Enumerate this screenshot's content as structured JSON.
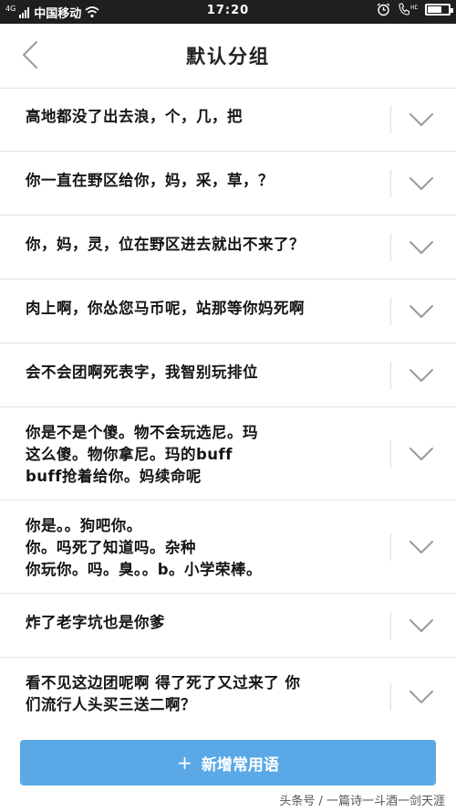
{
  "status_bar": {
    "network": "4G",
    "carrier": "中国移动",
    "time": "17:20",
    "battery_level": 0.7
  },
  "nav": {
    "title": "默认分组"
  },
  "phrases": [
    {
      "text": "高地都没了出去浪，个，几，把"
    },
    {
      "text": "你一直在野区给你，妈，采，草，？"
    },
    {
      "text": "你，妈，灵，位在野区进去就出不来了？"
    },
    {
      "text": "肉上啊，你怂您马币呢，站那等你妈死啊"
    },
    {
      "text": "会不会团啊死表字，我智别玩排位"
    },
    {
      "text": "你是不是个傻。物不会玩选尼。玛\n这么傻。物你拿尼。玛的buff\nbuff抢着给你。妈续命呢"
    },
    {
      "text": "你是。。狗吧你。\n你。吗死了知道吗。杂种\n你玩你。吗。臭。。b。小学荣棒。"
    },
    {
      "text": "炸了老字坑也是你爹"
    },
    {
      "text": "看不见这边团呢啊 得了死了又过来了 你\n们流行人头买三送二啊？"
    }
  ],
  "add_button": {
    "icon": "+",
    "label": "新增常用语"
  },
  "watermark": "头条号 / 一篇诗一斗酒一剑天涯",
  "colors": {
    "accent": "#5aa9e6",
    "status_bar": "#1f1f1f",
    "divider": "#e4e4e4"
  }
}
